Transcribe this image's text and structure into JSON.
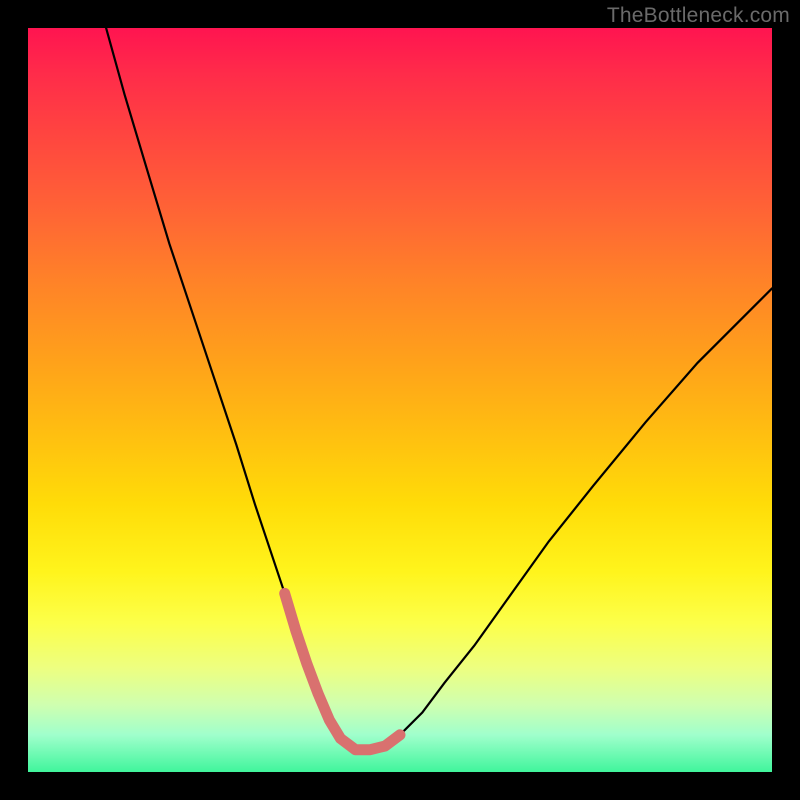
{
  "watermark": {
    "text": "TheBottleneck.com"
  },
  "chart_data": {
    "type": "line",
    "title": "",
    "xlabel": "",
    "ylabel": "",
    "xlim": [
      0,
      100
    ],
    "ylim": [
      0,
      100
    ],
    "series": [
      {
        "name": "main-curve",
        "color": "#000000",
        "x": [
          10.5,
          13,
          16,
          19,
          22,
          25,
          28,
          30.5,
          32.5,
          34.5,
          36,
          37.5,
          39,
          40.5,
          42,
          44,
          46,
          48,
          50,
          53,
          56,
          60,
          65,
          70,
          76,
          83,
          90,
          98,
          100
        ],
        "y": [
          100,
          91,
          81,
          71,
          62,
          53,
          44,
          36,
          30,
          24,
          19,
          14.5,
          10.5,
          7,
          4.5,
          3,
          3,
          3.5,
          5,
          8,
          12,
          17,
          24,
          31,
          38.5,
          47,
          55,
          63,
          65
        ]
      },
      {
        "name": "trough-highlight",
        "color": "#d9716f",
        "x": [
          34.5,
          36,
          37.5,
          39,
          40.5,
          42,
          44,
          46,
          48,
          50
        ],
        "y": [
          24,
          19,
          14.5,
          10.5,
          7,
          4.5,
          3,
          3,
          3.5,
          5
        ]
      }
    ]
  }
}
